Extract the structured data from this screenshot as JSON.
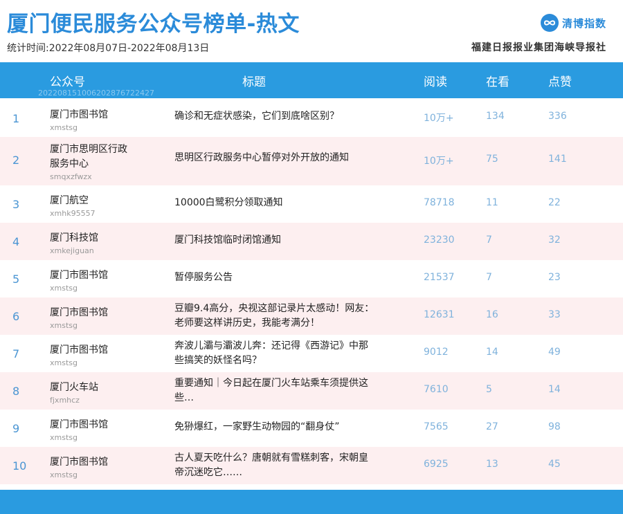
{
  "header": {
    "title": "厦门便民服务公众号榜单-热文",
    "period": "统计时间:2022年08月07日-2022年08月13日",
    "brand": "清博指数",
    "publisher": "福建日报报业集团海峡导报社"
  },
  "table": {
    "columns": [
      "公众号",
      "标题",
      "阅读",
      "在看",
      "点赞"
    ],
    "stamp": "20220815100620287672242​7",
    "rows": [
      {
        "rank": "1",
        "account": "厦门市图书馆",
        "account_id": "xmstsg",
        "title": "确诊和无症状感染，它们到底啥区别？",
        "read": "10万+",
        "looking": "134",
        "like": "336"
      },
      {
        "rank": "2",
        "account": "厦门市思明区行政服务中心",
        "account_id": "smqxzfwzx",
        "title": "思明区行政服务中心暂停对外开放的通知",
        "read": "10万+",
        "looking": "75",
        "like": "141"
      },
      {
        "rank": "3",
        "account": "厦门航空",
        "account_id": "xmhk95557",
        "title": "10000白鹭积分领取通知",
        "read": "78718",
        "looking": "11",
        "like": "22"
      },
      {
        "rank": "4",
        "account": "厦门科技馆",
        "account_id": "xmkejiguan",
        "title": "厦门科技馆临时闭馆通知",
        "read": "23230",
        "looking": "7",
        "like": "32"
      },
      {
        "rank": "5",
        "account": "厦门市图书馆",
        "account_id": "xmstsg",
        "title": "暂停服务公告",
        "read": "21537",
        "looking": "7",
        "like": "23"
      },
      {
        "rank": "6",
        "account": "厦门市图书馆",
        "account_id": "xmstsg",
        "title": "豆瓣9.4高分，央视这部记录片太感动！网友：老师要这样讲历史，我能考满分！",
        "read": "12631",
        "looking": "16",
        "like": "33"
      },
      {
        "rank": "7",
        "account": "厦门市图书馆",
        "account_id": "xmstsg",
        "title": "奔波儿灞与灞波儿奔：还记得《西游记》中那些搞笑的妖怪名吗？",
        "read": "9012",
        "looking": "14",
        "like": "49"
      },
      {
        "rank": "8",
        "account": "厦门火车站",
        "account_id": "fjxmhcz",
        "title": "重要通知｜今日起在厦门火车站乘车须提供这些…",
        "read": "7610",
        "looking": "5",
        "like": "14"
      },
      {
        "rank": "9",
        "account": "厦门市图书馆",
        "account_id": "xmstsg",
        "title": "免狲爆红，一家野生动物园的“翻身仗”",
        "read": "7565",
        "looking": "27",
        "like": "98"
      },
      {
        "rank": "10",
        "account": "厦门市图书馆",
        "account_id": "xmstsg",
        "title": "古人夏天吃什么？唐朝就有雪糕刺客，宋朝皇帝沉迷吃它……",
        "read": "6925",
        "looking": "13",
        "like": "45"
      }
    ]
  },
  "colors": {
    "accent": "#2a9be0",
    "title": "#2b8bd9",
    "row_alt": "#fdeff0",
    "number": "#7fb2dc"
  },
  "icons": {
    "brand": "infinity-logo-icon"
  }
}
